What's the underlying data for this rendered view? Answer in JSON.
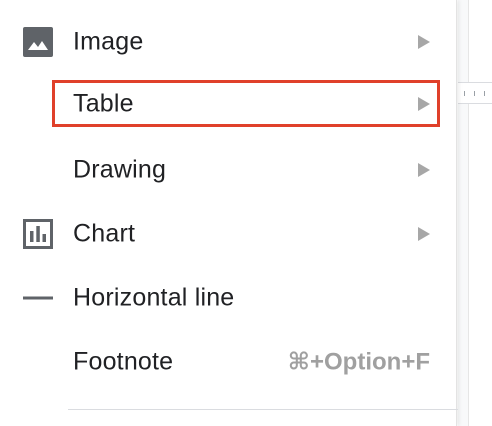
{
  "menu": {
    "items": [
      {
        "label": "Image",
        "icon": "image-icon",
        "submenu": true
      },
      {
        "label": "Table",
        "icon": null,
        "submenu": true,
        "highlighted": true
      },
      {
        "label": "Drawing",
        "icon": null,
        "submenu": true
      },
      {
        "label": "Chart",
        "icon": "chart-icon",
        "submenu": true
      },
      {
        "label": "Horizontal line",
        "icon": "horizontal-line-icon",
        "submenu": false
      },
      {
        "label": "Footnote",
        "icon": null,
        "submenu": false,
        "shortcut": "⌘+Option+F"
      }
    ]
  },
  "colors": {
    "highlight_border": "#e0402a",
    "text": "#202124",
    "icon": "#5f6368",
    "arrow": "#a7a7a7",
    "shortcut": "#a0a0a0"
  }
}
